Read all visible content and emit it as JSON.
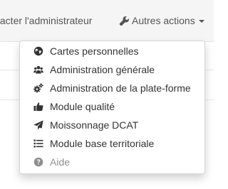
{
  "navbar": {
    "contact_label": "tacter l'administrateur",
    "actions_label": "Autres actions"
  },
  "dropdown": {
    "items": [
      {
        "label": "Cartes personnelles",
        "icon": "globe-icon"
      },
      {
        "label": "Administration générale",
        "icon": "users-icon"
      },
      {
        "label": "Administration de la plate-forme",
        "icon": "cogs-icon"
      },
      {
        "label": "Module qualité",
        "icon": "thumbs-up-icon"
      },
      {
        "label": "Moissonnage DCAT",
        "icon": "paper-plane-icon"
      },
      {
        "label": "Module base territoriale",
        "icon": "list-icon"
      },
      {
        "label": "Aide",
        "icon": "question-circle-icon",
        "disabled": true
      }
    ]
  },
  "colors": {
    "navbar_bg": "#f5f5f5",
    "text": "#333333",
    "disabled_text": "#8f8f8f"
  }
}
